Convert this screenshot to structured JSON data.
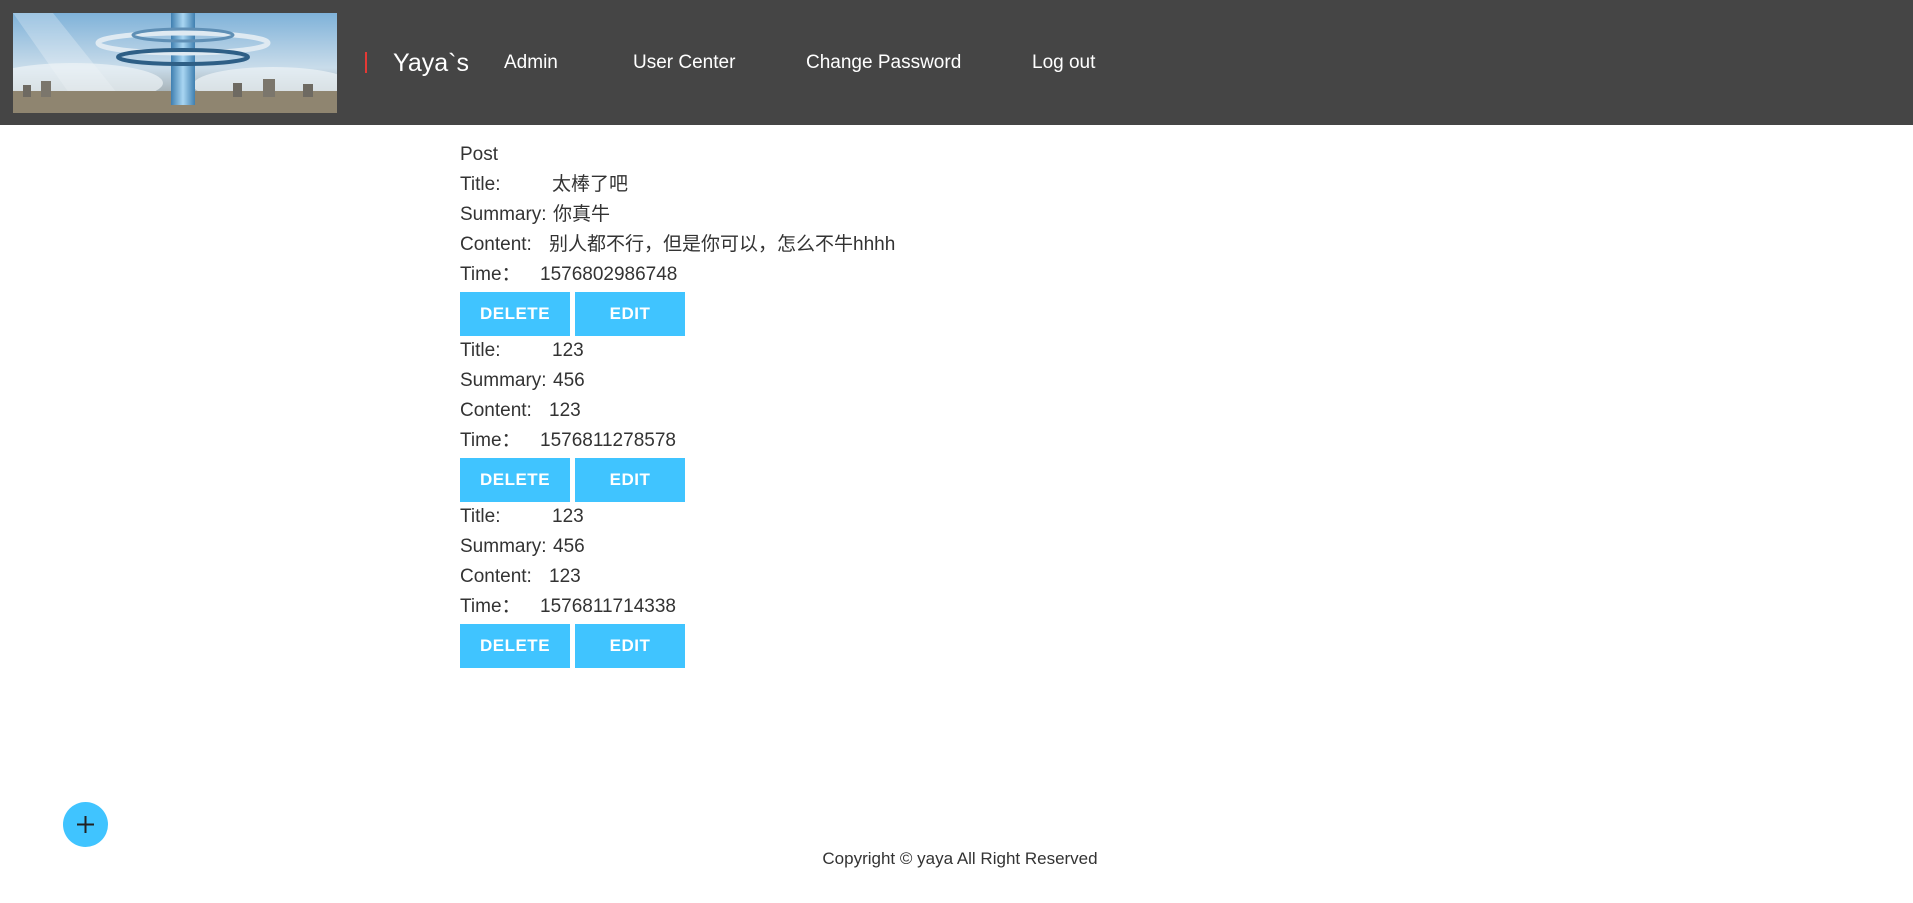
{
  "colors": {
    "header_bg": "#454545",
    "accent": "#40c4ff",
    "brand_divider": "#e53935"
  },
  "header": {
    "banner_alt": "",
    "brand": "Yaya`s",
    "nav": [
      {
        "label": "Admin"
      },
      {
        "label": "User Center"
      },
      {
        "label": "Change Password"
      },
      {
        "label": "Log out"
      }
    ]
  },
  "main": {
    "section_title": "Post",
    "labels": {
      "title": "Title:",
      "summary": "Summary:",
      "content": "Content:",
      "time": "Time："
    },
    "delete_label": "DELETE",
    "edit_label": "EDIT",
    "posts": [
      {
        "title": "太棒了吧",
        "summary": "你真牛",
        "content": "别人都不行，但是你可以，怎么不牛hhhh",
        "time": "1576802986748"
      },
      {
        "title": "123",
        "summary": "456",
        "content": "123",
        "time": "1576811278578"
      },
      {
        "title": "123",
        "summary": "456",
        "content": "123",
        "time": "1576811714338"
      }
    ]
  },
  "fab": {
    "icon": "plus-icon"
  },
  "footer": {
    "copyright": "Copyright © yaya All Right Reserved"
  }
}
